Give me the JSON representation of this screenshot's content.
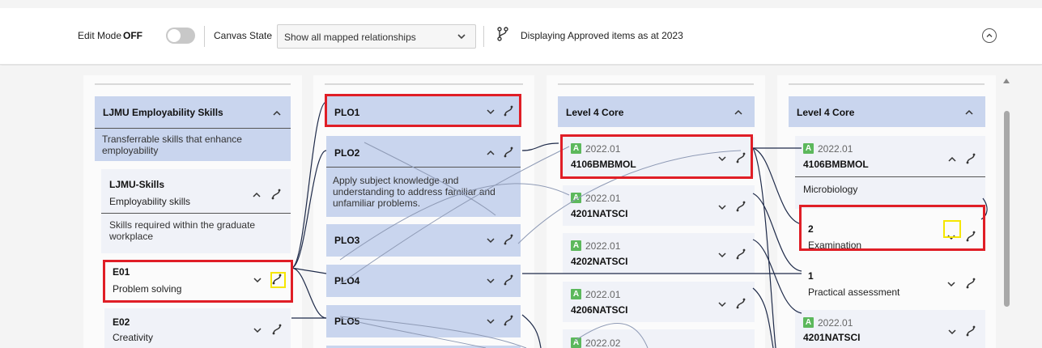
{
  "toolbar": {
    "edit_mode_label": "Edit Mode",
    "edit_mode_state": "OFF",
    "canvas_state_label": "Canvas State",
    "canvas_state_value": "Show all mapped relationships",
    "display_text": "Displaying Approved items as at 2023"
  },
  "col1": {
    "header_title": "LJMU Employability Skills",
    "header_desc": "Transferrable skills that enhance employability",
    "skills_title": "LJMU-Skills",
    "skills_sub": "Employability skills",
    "skills_desc": "Skills required within the graduate workplace",
    "e01_title": "E01",
    "e01_sub": "Problem solving",
    "e02_title": "E02",
    "e02_sub": "Creativity"
  },
  "col2": {
    "plo1": "PLO1",
    "plo2": "PLO2",
    "plo2_desc": "Apply subject knowledge and understanding to address familiar and unfamiliar problems.",
    "plo3": "PLO3",
    "plo4": "PLO4",
    "plo5": "PLO5"
  },
  "col3": {
    "header_title": "Level 4 Core",
    "items": [
      {
        "badge": "A",
        "version": "2022.01",
        "code": "4106BMBMOL"
      },
      {
        "badge": "A",
        "version": "2022.01",
        "code": "4201NATSCI"
      },
      {
        "badge": "A",
        "version": "2022.01",
        "code": "4202NATSCI"
      },
      {
        "badge": "A",
        "version": "2022.01",
        "code": "4206NATSCI"
      },
      {
        "badge": "A",
        "version": "2022.02",
        "code": ""
      }
    ]
  },
  "col4": {
    "header_title": "Level 4 Core",
    "module_badge": "A",
    "module_version": "2022.01",
    "module_code": "4106BMBMOL",
    "module_desc": "Microbiology",
    "assess1_num": "2",
    "assess1_name": "Examination",
    "assess2_num": "1",
    "assess2_name": "Practical assessment",
    "module2_badge": "A",
    "module2_version": "2022.01",
    "module2_code": "4201NATSCI"
  },
  "colors": {
    "header_card": "#c9d5ee",
    "highlight_red": "#e01e26",
    "highlight_yellow": "#f5e600",
    "approved_badge": "#5cb85c"
  }
}
